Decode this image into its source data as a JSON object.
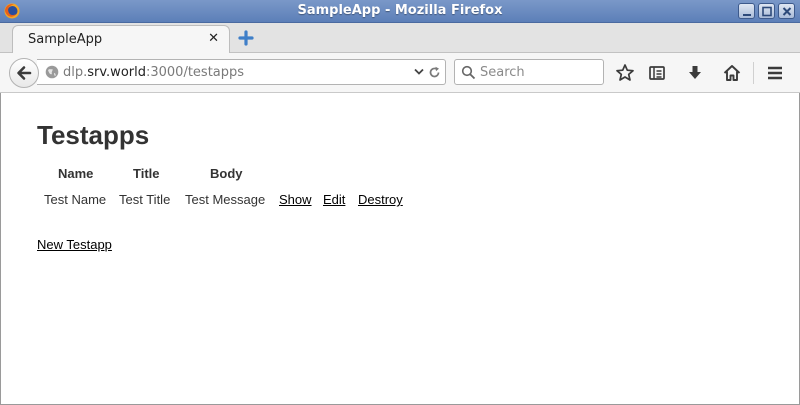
{
  "window": {
    "title": "SampleApp - Mozilla Firefox"
  },
  "tabs": [
    {
      "label": "SampleApp",
      "close": "✕"
    }
  ],
  "urlbar": {
    "prefix": "dlp.",
    "host": "srv.world",
    "suffix": ":3000/testapps"
  },
  "search": {
    "placeholder": "Search"
  },
  "toolbar_icons": [
    "bookmark-star-icon",
    "reading-list-icon",
    "download-icon",
    "home-icon",
    "menu-icon"
  ],
  "page": {
    "heading": "Testapps",
    "table": {
      "headers": [
        "Name",
        "Title",
        "Body"
      ],
      "rows": [
        {
          "name": "Test Name",
          "title": "Test Title",
          "body": "Test Message",
          "actions": [
            "Show",
            "Edit",
            "Destroy"
          ]
        }
      ]
    },
    "new_link": "New Testapp"
  },
  "colors": {
    "titlebar": "#6a8cc2",
    "link": "#000000",
    "text": "#333333"
  }
}
